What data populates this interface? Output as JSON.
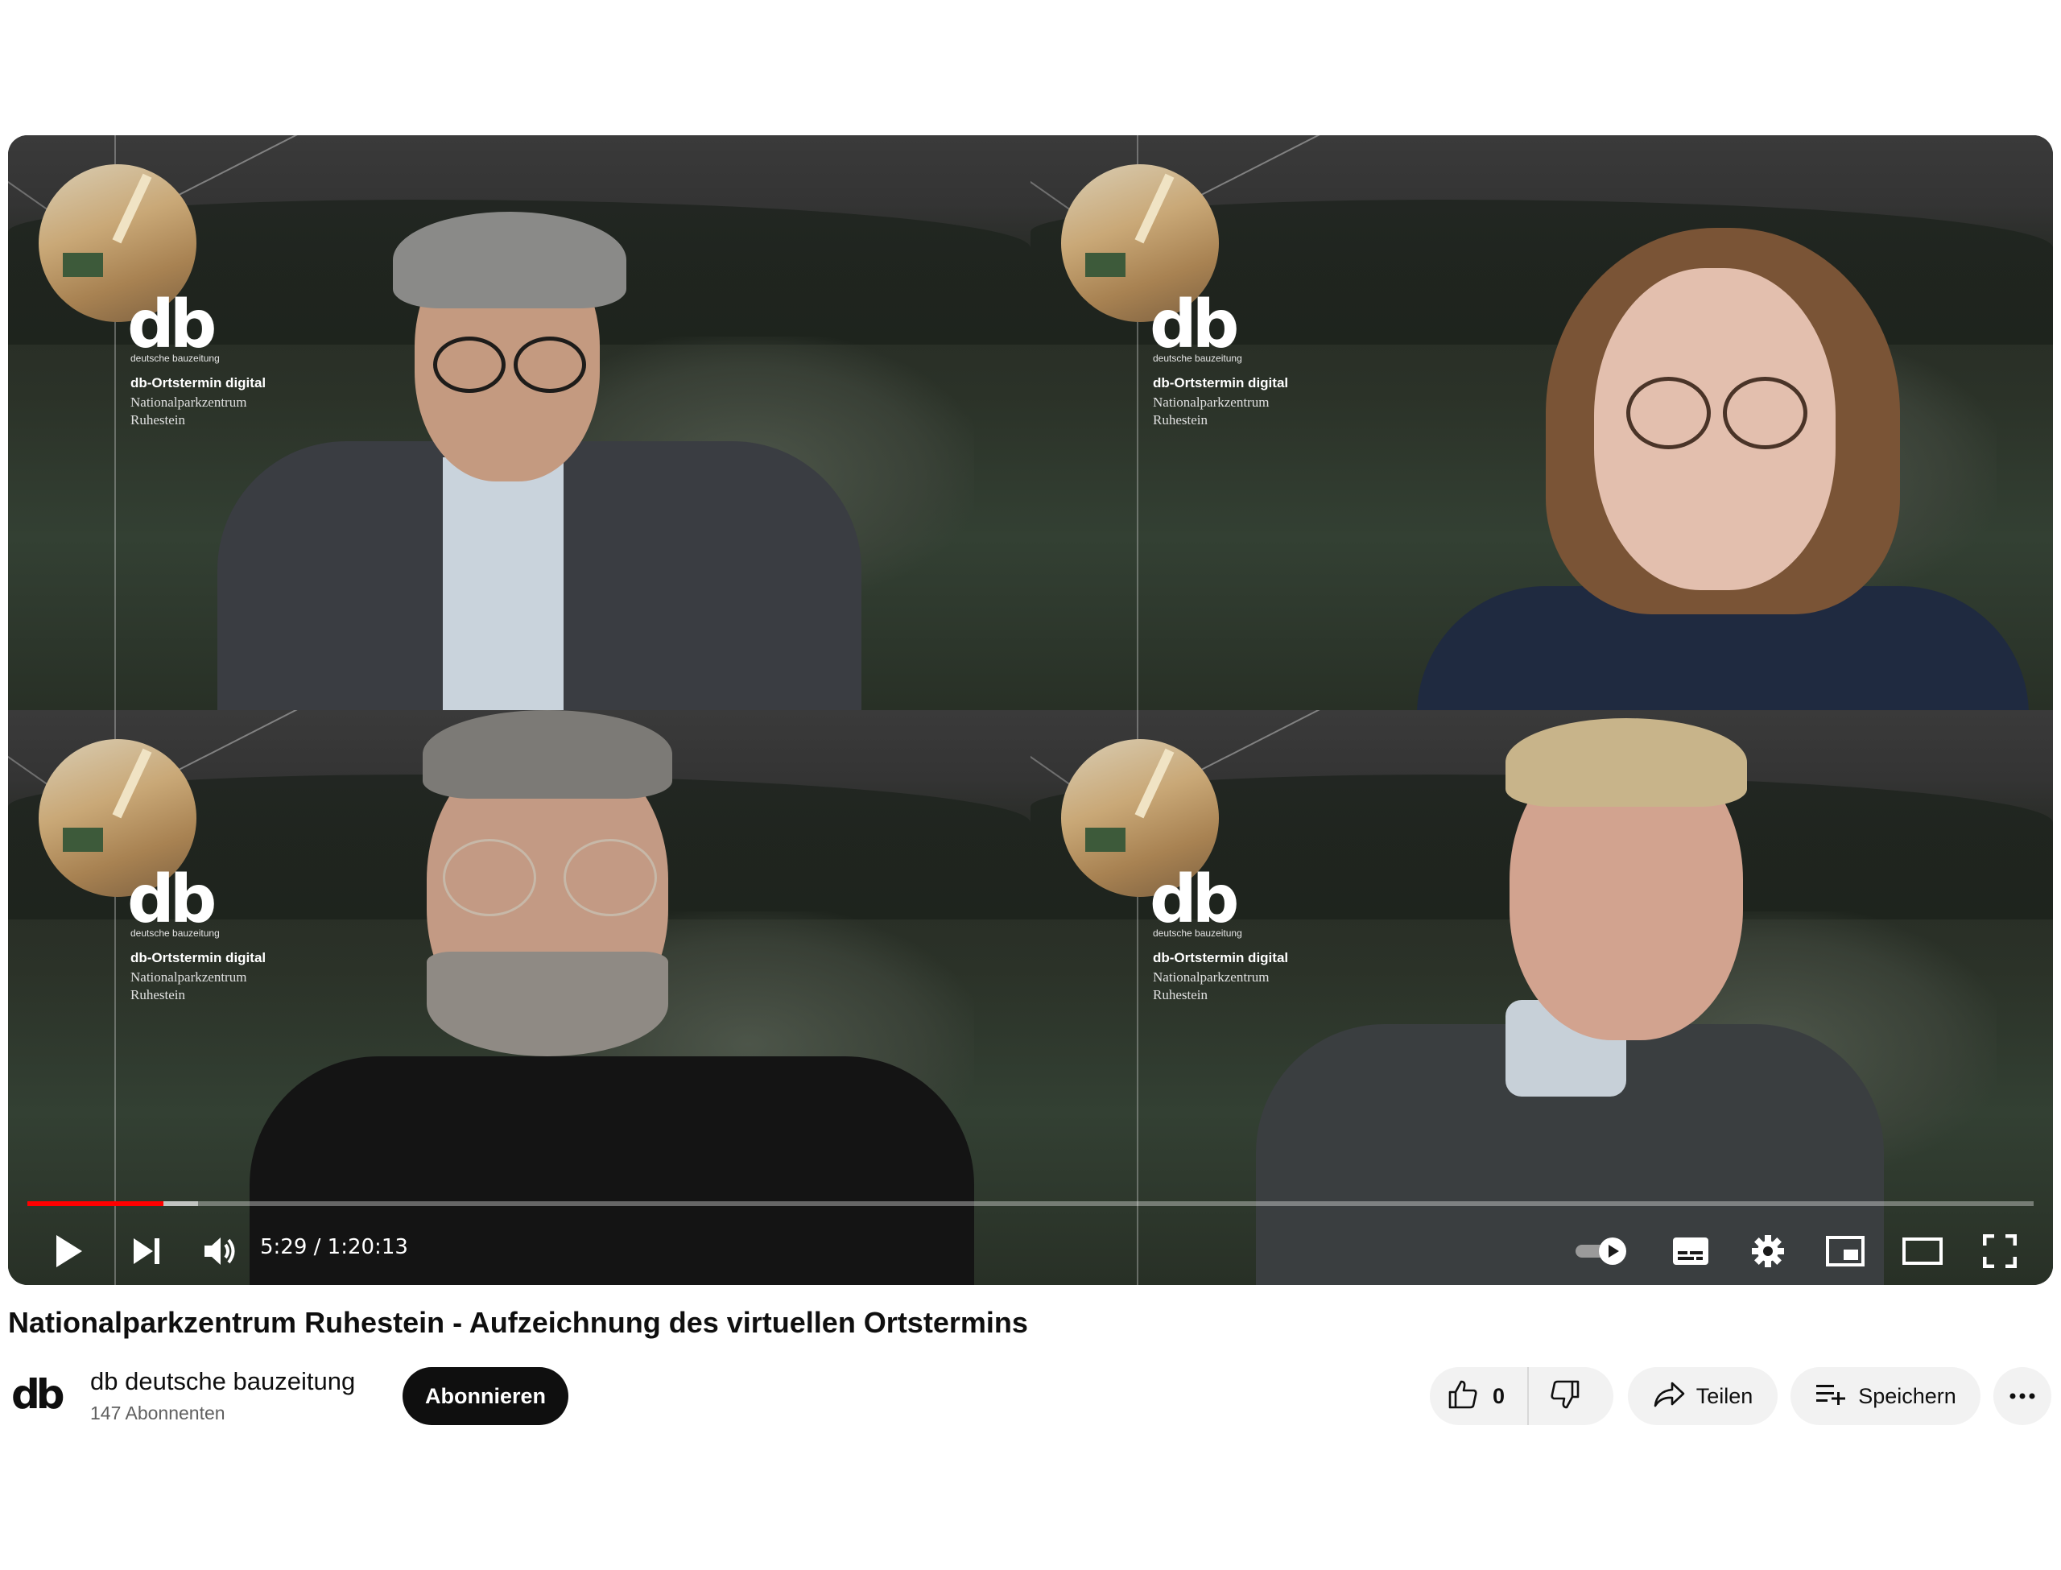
{
  "player": {
    "overlay": {
      "logo": "db",
      "logo_sub": "deutsche bauzeitung",
      "line1": "db-Ortstermin digital",
      "line2": "Nationalparkzentrum",
      "line3": "Ruhestein"
    },
    "time_display": "5:29 / 1:20:13",
    "progress_played": 0.068,
    "progress_loaded": 0.085
  },
  "video": {
    "title": "Nationalparkzentrum Ruhestein - Aufzeichnung des virtuellen Ortstermins"
  },
  "channel": {
    "logo": "db",
    "name": "db deutsche bauzeitung",
    "subscribers": "147 Abonnenten",
    "subscribe_label": "Abonnieren"
  },
  "actions": {
    "like_count": "0",
    "share_label": "Teilen",
    "save_label": "Speichern"
  },
  "colors": {
    "progress": "#ff0000",
    "subscribe_bg": "#0f0f0f",
    "pill_bg": "#f2f2f2"
  },
  "icons": {
    "play": "play-icon",
    "next": "next-icon",
    "volume": "volume-icon",
    "autoplay": "autoplay-toggle-icon",
    "subtitles": "subtitles-icon",
    "settings": "gear-icon",
    "miniplayer": "miniplayer-icon",
    "theater": "theater-icon",
    "fullscreen": "fullscreen-icon",
    "like": "thumbs-up-icon",
    "dislike": "thumbs-down-icon",
    "share": "share-icon",
    "save": "playlist-add-icon",
    "more": "more-icon"
  }
}
